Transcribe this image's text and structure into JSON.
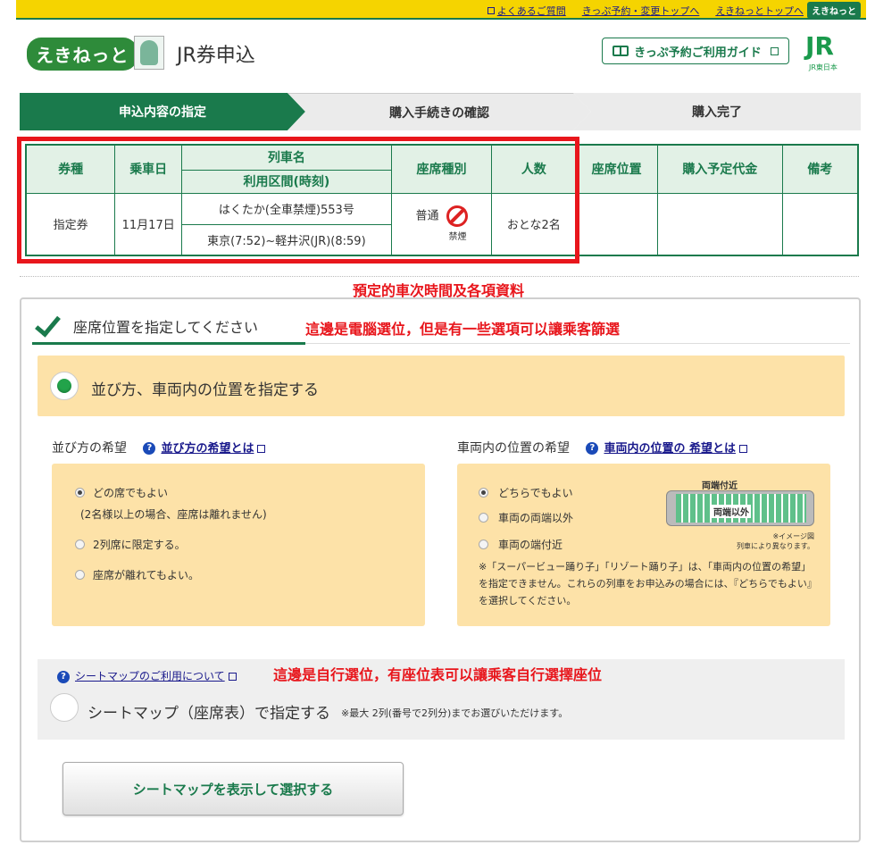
{
  "topbar": {
    "links": [
      "よくあるご質問",
      "きっぷ予約・変更トップへ",
      "えきねっとトップへ"
    ],
    "badge": "えきねっと"
  },
  "header": {
    "logo": "えきねっと",
    "title": "JR券申込",
    "guide_label": "きっぷ予約ご利用ガイド",
    "jr_logo": "JR",
    "jr_sub": "JR東日本"
  },
  "steps": [
    "申込内容の指定",
    "購入手続きの確認",
    "購入完了"
  ],
  "table": {
    "headers": {
      "ticket_type": "券種",
      "date": "乗車日",
      "train_name": "列車名",
      "section": "利用区間(時刻)",
      "seat_type": "座席種別",
      "people": "人数",
      "seat_pos": "座席位置",
      "price": "購入予定代金",
      "remarks": "備考"
    },
    "row": {
      "ticket_type": "指定券",
      "date": "11月17日",
      "train_name": "はくたか(全車禁煙)553号",
      "section": "東京(7:52)~軽井沢(JR)(8:59)",
      "seat_type": "普通",
      "no_smoke": "禁煙",
      "people": "おとな2名"
    }
  },
  "annotations": {
    "a1": "預定的車次時間及各項資料",
    "a2": "這邊是電腦選位，但是有一些選項可以讓乘客篩選",
    "a3": "這邊是自行選位，有座位表可以讓乘客自行選擇座位"
  },
  "panel": {
    "title": "座席位置を指定してください",
    "option_a": "並び方、車両内の位置を指定する",
    "left": {
      "head": "並び方の希望",
      "link": "並び方の希望とは",
      "opt1": "どの席でもよい",
      "opt1_note": "(2名様以上の場合、座席は離れません)",
      "opt2": "2列席に限定する。",
      "opt3": "座席が離れてもよい。"
    },
    "right": {
      "head": "車両内の位置の希望",
      "link": "車両内の位置の 希望とは",
      "opt1": "どちらでもよい",
      "opt2": "車両の両端以外",
      "opt3": "車両の端付近",
      "diagram_top": "両端付近",
      "diagram_mid": "両端以外",
      "diagram_note1": "※イメージ図",
      "diagram_note2": "列車により異なります。",
      "note": "※「スーパービュー踊り子」「リゾート踊り子」は、「車両内の位置の希望」を指定できません。これらの列車をお申込みの場合には、『どちらでもよい』を選択してください。"
    },
    "seatmap_link": "シートマップのご利用について",
    "option_b": "シートマップ（座席表）で指定する",
    "option_b_note": "※最大 2列(番号で2列分)までお選びいただけます。",
    "button": "シートマップを表示して選択する"
  }
}
